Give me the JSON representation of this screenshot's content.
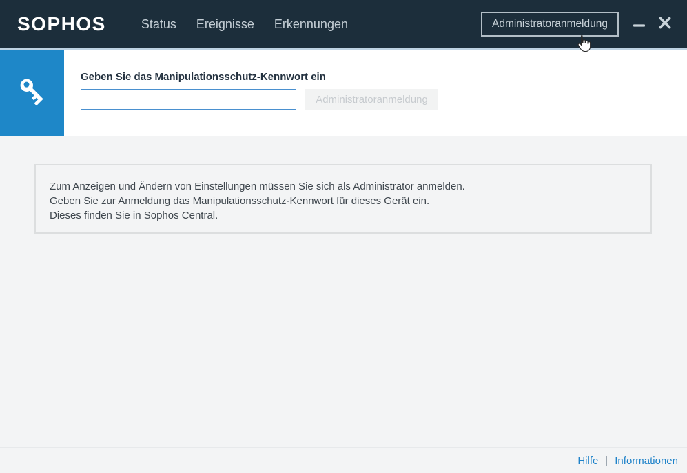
{
  "titlebar": {
    "logo": "SOPHOS",
    "nav": [
      {
        "label": "Status"
      },
      {
        "label": "Ereignisse"
      },
      {
        "label": "Erkennungen"
      }
    ],
    "admin_login_button": "Administratoranmeldung",
    "icons": {
      "minimize": "minimize-icon",
      "close": "close-icon"
    }
  },
  "tamper_panel": {
    "icon": "key-icon",
    "heading": "Geben Sie das Manipulationsschutz-Kennwort ein",
    "password_input": {
      "value": "",
      "placeholder": ""
    },
    "submit_button": {
      "label": "Administratoranmeldung",
      "state": "disabled"
    }
  },
  "info_box": {
    "lines": [
      "Zum Anzeigen und Ändern von Einstellungen müssen Sie sich als Administrator anmelden.",
      "Geben Sie zur Anmeldung das Manipulationsschutz-Kennwort für dieses Gerät ein.",
      "Dieses finden Sie in Sophos Central."
    ]
  },
  "footer": {
    "links": [
      {
        "label": "Hilfe"
      },
      {
        "label": "Informationen"
      }
    ],
    "separator": "|"
  },
  "cursor": {
    "type": "hand-pointer"
  },
  "colors": {
    "header_bg": "#1c2e3b",
    "accent_blue": "#1e87c8",
    "link_blue": "#1e82c9",
    "page_bg": "#f3f4f5",
    "input_border": "#4a90cf",
    "header_text": "#c5cfd6"
  }
}
